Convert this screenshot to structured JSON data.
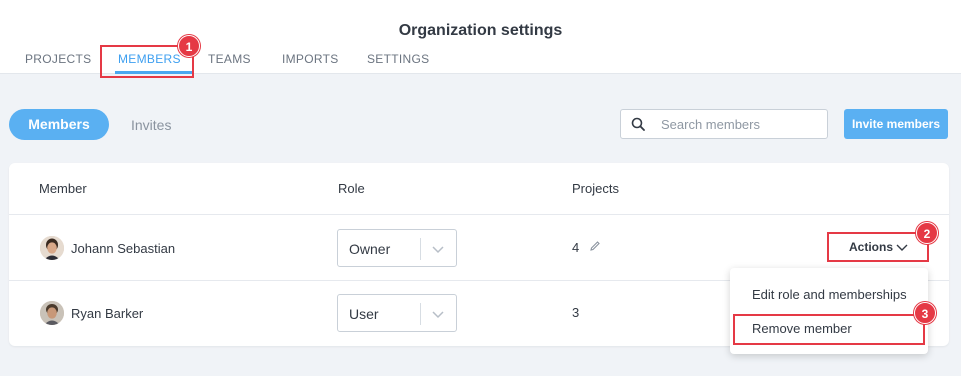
{
  "header": {
    "title": "Organization settings"
  },
  "tabs": [
    {
      "label": "PROJECTS"
    },
    {
      "label": "MEMBERS"
    },
    {
      "label": "TEAMS"
    },
    {
      "label": "IMPORTS"
    },
    {
      "label": "SETTINGS"
    }
  ],
  "active_tab": "MEMBERS",
  "toggle": {
    "members": "Members",
    "invites": "Invites"
  },
  "search": {
    "placeholder": "Search members",
    "value": ""
  },
  "invite_button": "Invite members",
  "table": {
    "headers": {
      "member": "Member",
      "role": "Role",
      "projects": "Projects"
    },
    "rows": [
      {
        "name": "Johann Sebastian",
        "role": "Owner",
        "projects": "4"
      },
      {
        "name": "Ryan Barker",
        "role": "User",
        "projects": "3"
      }
    ]
  },
  "actions": {
    "label": "Actions"
  },
  "actions_menu": [
    {
      "label": "Edit role and memberships"
    },
    {
      "label": "Remove member"
    }
  ],
  "annotations": [
    "1",
    "2",
    "3"
  ],
  "icons": {
    "search": "search-icon",
    "chevron": "chevron-down-icon",
    "edit": "pencil-icon"
  },
  "colors": {
    "accent": "#4aa8f0",
    "button": "#5ab0f2",
    "annotation": "#e53945",
    "background": "#f0f3f7"
  }
}
